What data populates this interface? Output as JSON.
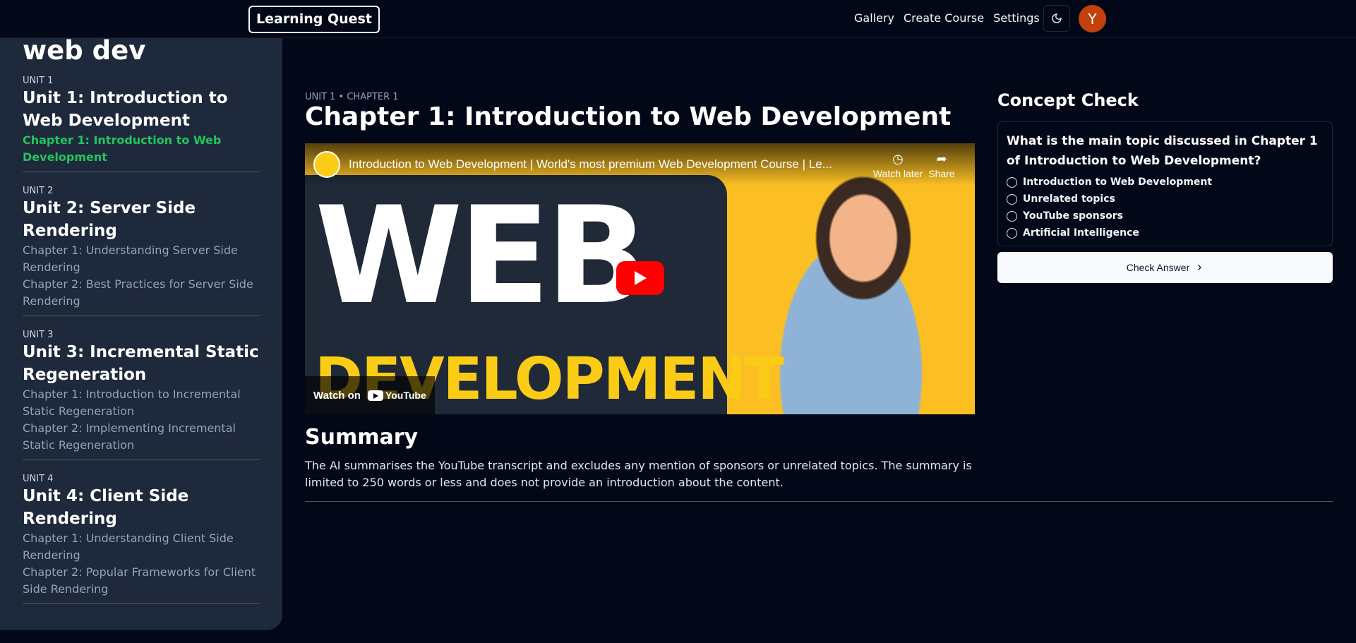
{
  "nav": {
    "logo": "Learning Quest",
    "links": [
      "Gallery",
      "Create Course",
      "Settings"
    ],
    "avatar_letter": "Y"
  },
  "sidebar": {
    "course_title": "web dev",
    "units": [
      {
        "tag": "UNIT 1",
        "title": "Unit 1: Introduction to Web Development",
        "chapters": [
          "Chapter 1: Introduction to Web Development"
        ]
      },
      {
        "tag": "UNIT 2",
        "title": "Unit 2: Server Side Rendering",
        "chapters": [
          "Chapter 1: Understanding Server Side Rendering",
          "Chapter 2: Best Practices for Server Side Rendering"
        ]
      },
      {
        "tag": "UNIT 3",
        "title": "Unit 3: Incremental Static Regeneration",
        "chapters": [
          "Chapter 1: Introduction to Incremental Static Regeneration",
          "Chapter 2: Implementing Incremental Static Regeneration"
        ]
      },
      {
        "tag": "UNIT 4",
        "title": "Unit 4: Client Side Rendering",
        "chapters": [
          "Chapter 1: Understanding Client Side Rendering",
          "Chapter 2: Popular Frameworks for Client Side Rendering"
        ]
      }
    ]
  },
  "main": {
    "crumb": "UNIT 1 • CHAPTER 1",
    "chapter_title": "Chapter 1: Introduction to Web Development",
    "video": {
      "title": "Introduction to Web Development | World's most premium Web Development Course | Le...",
      "watch_later": "Watch later",
      "share": "Share",
      "watch_on": "Watch on",
      "youtube": "YouTube",
      "thumb_line1": "WEB",
      "thumb_line2": "DEVELOPMENT"
    },
    "summary_title": "Summary",
    "summary_text": "The AI summarises the YouTube transcript and excludes any mention of sponsors or unrelated topics. The summary is limited to 250 words or less and does not provide an introduction about the content."
  },
  "concept_check": {
    "title": "Concept Check",
    "question": "What is the main topic discussed in Chapter 1 of Introduction to Web Development?",
    "options": [
      "Introduction to Web Development",
      "Unrelated topics",
      "YouTube sponsors",
      "Artificial Intelligence"
    ],
    "button": "Check Answer"
  },
  "colors": {
    "background": "#020817",
    "sidebar": "#1e293b",
    "active_chapter": "#22c55e",
    "avatar": "#c2410c"
  }
}
